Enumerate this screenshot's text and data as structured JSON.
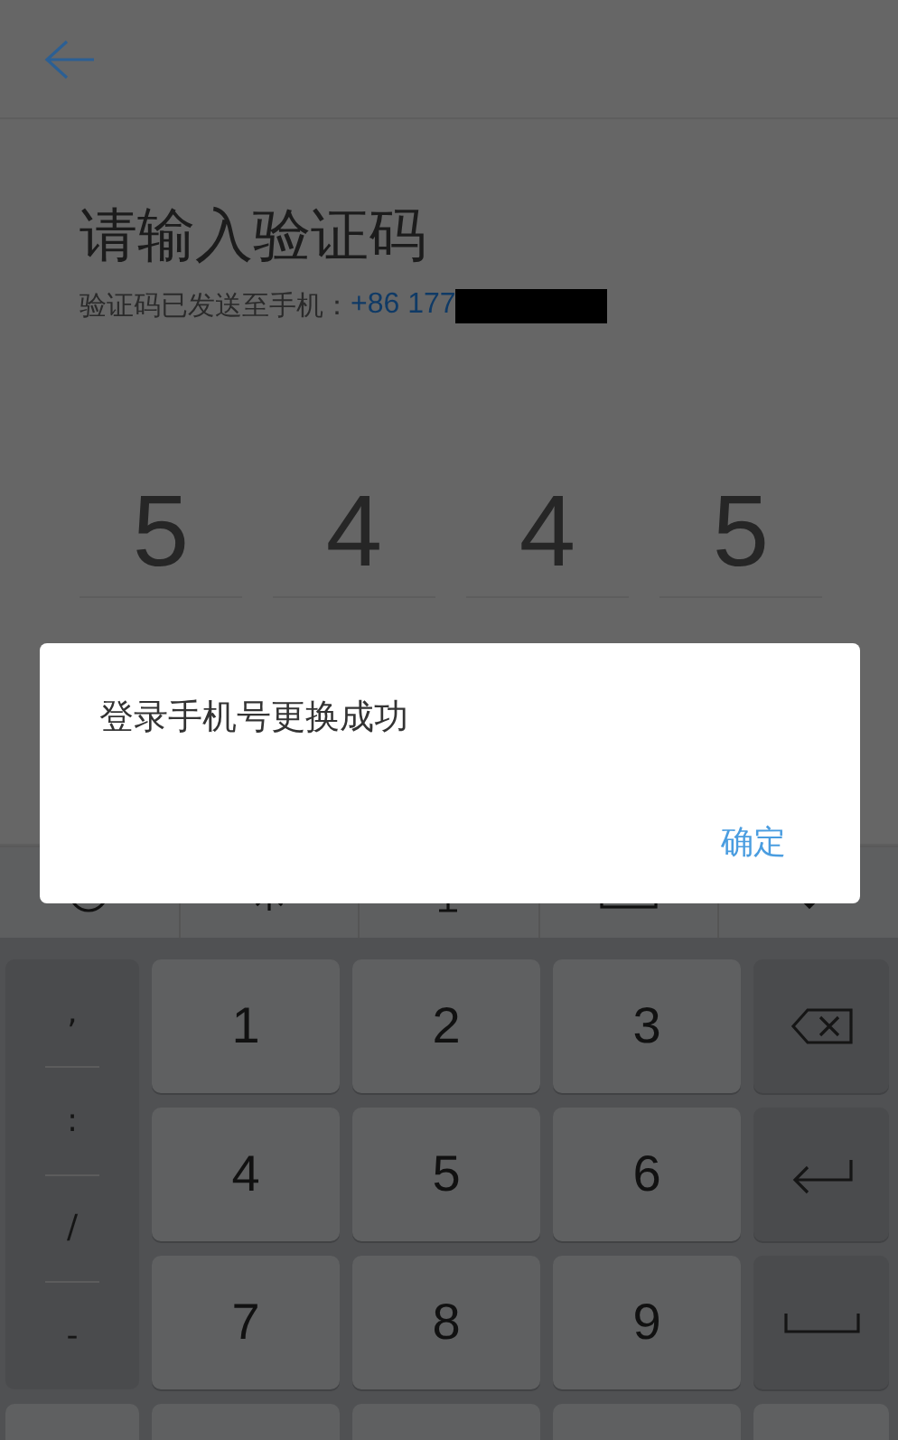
{
  "title": "请输入验证码",
  "subtitle": {
    "text": "验证码已发送至手机：",
    "phone": "+86 177"
  },
  "code_digits": [
    "5",
    "4",
    "4",
    "5"
  ],
  "keyboard": {
    "toolbar": [
      {
        "kind": "emoji"
      },
      {
        "kind": "gear"
      },
      {
        "kind": "mic"
      },
      {
        "kind": "keyboard"
      },
      {
        "kind": "hide"
      }
    ],
    "symbols": [
      ",",
      ":",
      "/",
      "-"
    ],
    "rows": [
      {
        "keys": [
          {
            "kind": "digit",
            "label": "1"
          },
          {
            "kind": "digit",
            "label": "2"
          },
          {
            "kind": "digit",
            "label": "3"
          },
          {
            "kind": "backspace"
          }
        ]
      },
      {
        "keys": [
          {
            "kind": "digit",
            "label": "4"
          },
          {
            "kind": "digit",
            "label": "5"
          },
          {
            "kind": "digit",
            "label": "6"
          },
          {
            "kind": "enter"
          }
        ]
      },
      {
        "keys": [
          {
            "kind": "digit",
            "label": "7"
          },
          {
            "kind": "digit",
            "label": "8"
          },
          {
            "kind": "digit",
            "label": "9"
          },
          {
            "kind": "space"
          }
        ]
      },
      {
        "keys": [
          {
            "kind": "blank"
          },
          {
            "kind": "blank"
          },
          {
            "kind": "blank"
          },
          {
            "kind": "blank"
          },
          {
            "kind": "blank"
          }
        ]
      }
    ]
  },
  "dialog": {
    "message": "登录手机号更换成功",
    "buttons": [
      "确定"
    ]
  }
}
